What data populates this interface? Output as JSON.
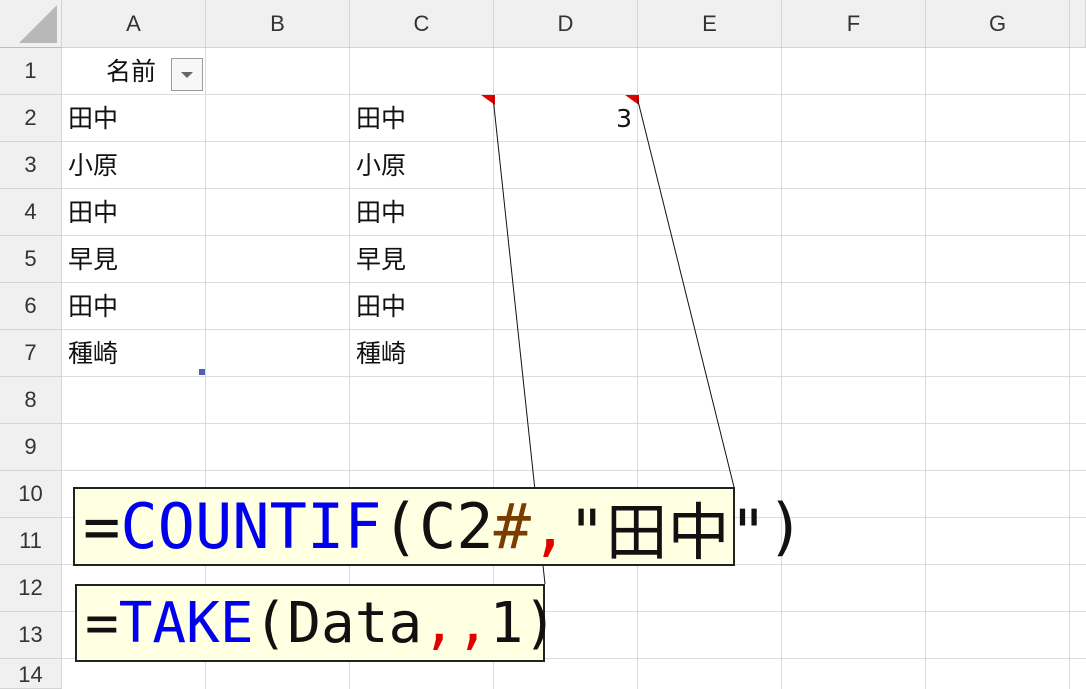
{
  "sheet": {
    "columns": [
      "A",
      "B",
      "C",
      "D",
      "E",
      "F",
      "G"
    ],
    "rows": [
      "1",
      "2",
      "3",
      "4",
      "5",
      "6",
      "7",
      "8",
      "9",
      "10",
      "11",
      "12",
      "13",
      "14"
    ],
    "header": {
      "a1": "名前"
    },
    "column_a": [
      "田中",
      "小原",
      "田中",
      "早見",
      "田中",
      "種崎"
    ],
    "column_c": [
      "田中",
      "小原",
      "田中",
      "早見",
      "田中",
      "種崎"
    ],
    "e2_value": "3"
  },
  "formula_countif": {
    "equals": "=",
    "func": "COUNTIF",
    "open": "(",
    "ref": "C2",
    "spill": "#",
    "comma": ",",
    "criteria": "\"田中\"",
    "close": ")"
  },
  "formula_take": {
    "equals": "=",
    "func": "TAKE",
    "open": "(",
    "arg": "Data",
    "commas": ",,",
    "num": "1",
    "close": ")"
  },
  "colors": {
    "function_blue": "#0000ee",
    "spill_brown": "#7a3c00",
    "comma_red": "#e00000",
    "note_bg": "#ffffe1",
    "comment_red": "#e00000"
  },
  "icons": {
    "filter": "dropdown-arrow-icon",
    "spill_handle": "spill-range-handle-icon"
  }
}
